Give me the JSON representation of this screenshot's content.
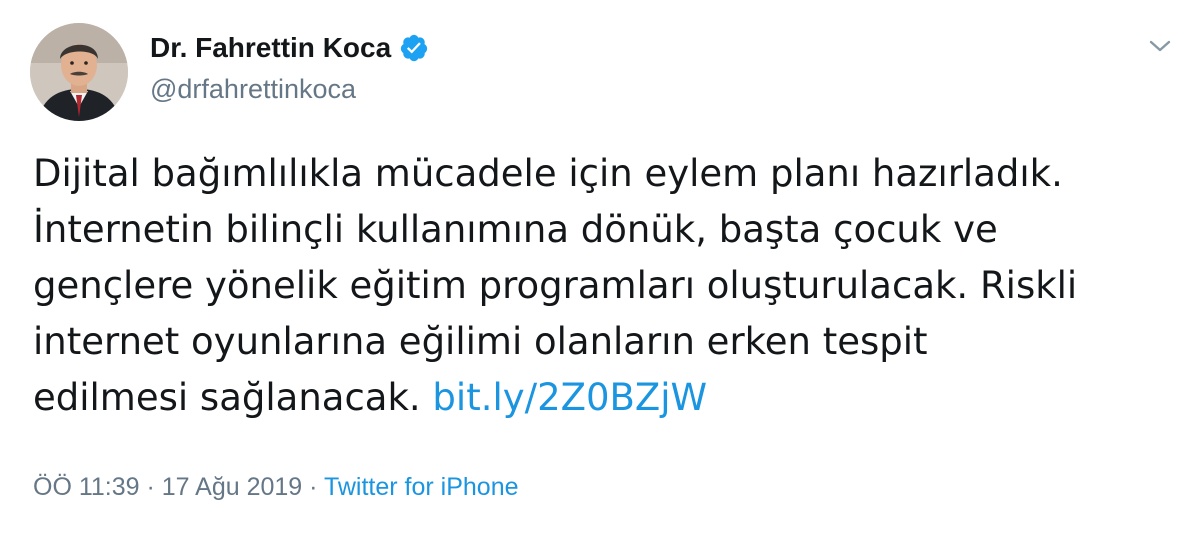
{
  "author": {
    "display_name": "Dr. Fahrettin Koca",
    "handle": "@drfahrettinkoca",
    "verified": true
  },
  "tweet": {
    "lines": [
      "Dijital bağımlılıkla mücadele için eylem planı hazırladık.",
      "İnternetin bilinçli kullanımına dönük, başta çocuk ve",
      "gençlere yönelik eğitim programları oluşturulacak. Riskli",
      "internet oyunlarına eğilimi olanların erken tespit",
      "edilmesi sağlanacak."
    ],
    "link_text": "bit.ly/2Z0BZjW"
  },
  "meta": {
    "time": "ÖÖ 11:39",
    "separator1": "·",
    "date": "17 Ağu 2019",
    "separator2": "·",
    "source": "Twitter for iPhone"
  },
  "icons": {
    "verified": "verified-badge-icon",
    "menu": "chevron-down-icon"
  },
  "colors": {
    "text": "#14171a",
    "secondary": "#657786",
    "link": "#1b95e0",
    "verified": "#1da1f2"
  }
}
